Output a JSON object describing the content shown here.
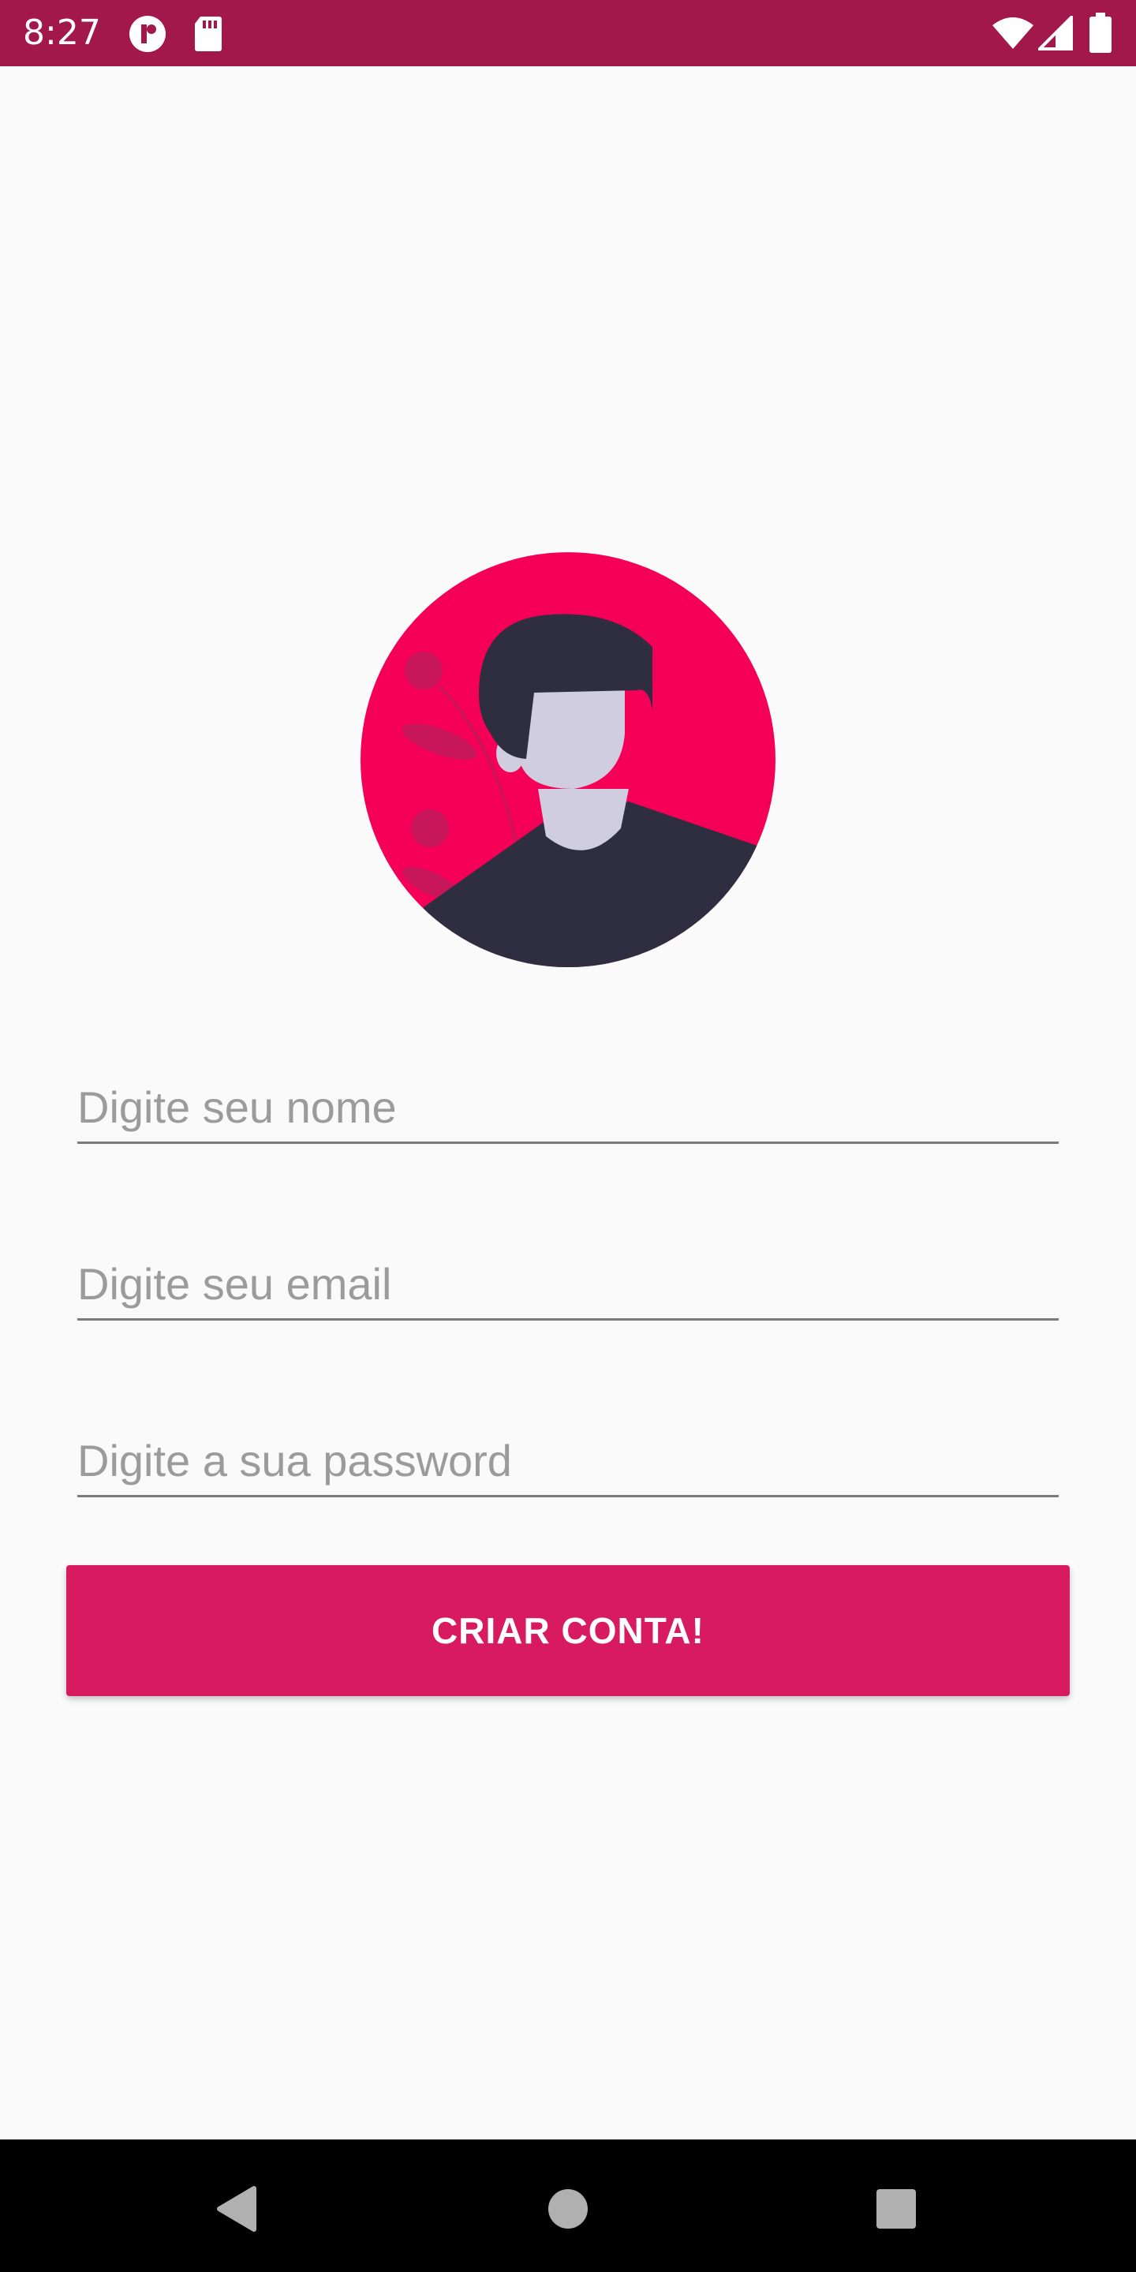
{
  "status_bar": {
    "time": "8:27",
    "icons_left": [
      "notification-app-icon",
      "sd-card-icon"
    ],
    "icons_right": [
      "wifi-icon",
      "cell-signal-icon",
      "battery-icon"
    ],
    "background_color": "#a2184a"
  },
  "avatar": {
    "icon": "user-avatar-illustration",
    "background_color": "#f50057",
    "figure_color": "#2f2e41",
    "skin_color": "#d0cde1"
  },
  "form": {
    "name_placeholder": "Digite seu nome",
    "email_placeholder": "Digite seu email",
    "password_placeholder": "Digite a sua password",
    "submit_label": "CRIAR CONTA!",
    "accent_color": "#d81b60"
  },
  "nav_bar": {
    "buttons": [
      "back-icon",
      "home-icon",
      "recents-icon"
    ]
  }
}
